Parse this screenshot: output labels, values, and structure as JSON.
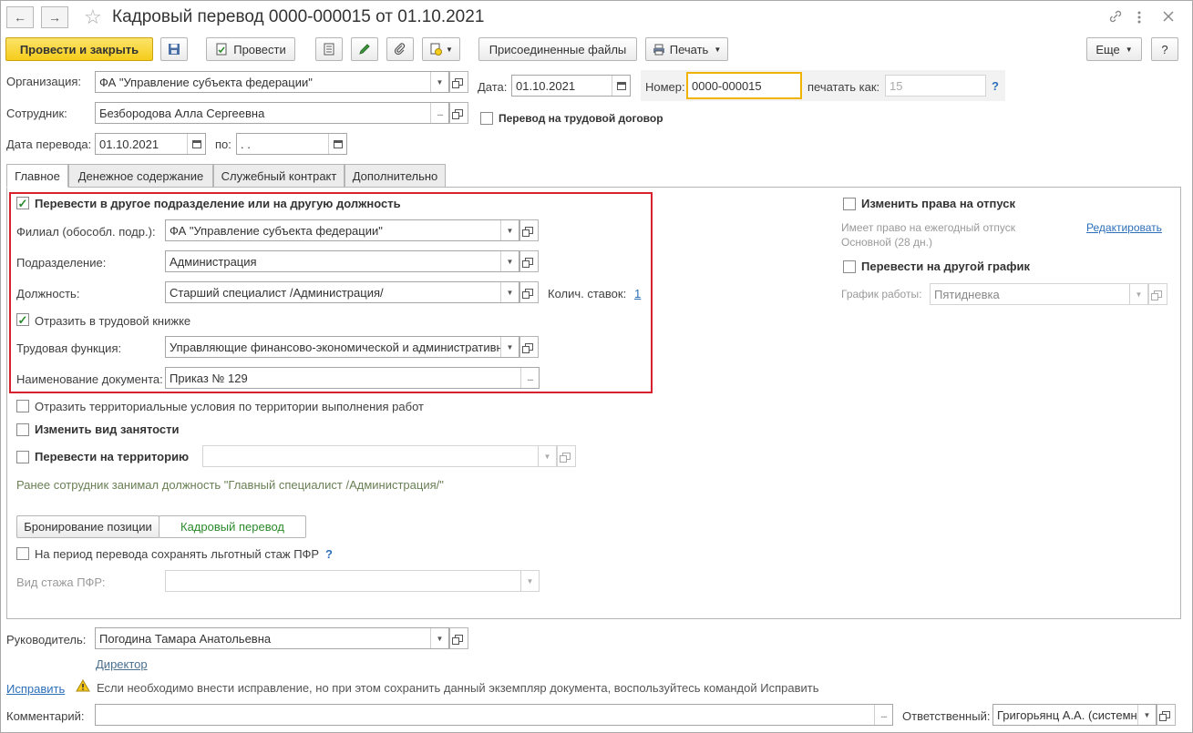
{
  "window": {
    "title": "Кадровый перевод 0000-000015 от 01.10.2021",
    "back_icon": "←",
    "forward_icon": "→",
    "star_icon": "☆"
  },
  "toolbar": {
    "post_close": "Провести и закрыть",
    "post": "Провести",
    "attached_files": "Присоединенные файлы",
    "print": "Печать",
    "more": "Еще",
    "help": "?"
  },
  "header": {
    "org_label": "Организация:",
    "org_value": "ФА \"Управление субъекта федерации\"",
    "date_label": "Дата:",
    "date_value": "01.10.2021",
    "number_label": "Номер:",
    "number_value": "0000-000015",
    "print_as_label": "печатать как:",
    "print_as_value": "15",
    "help_q": "?",
    "employee_label": "Сотрудник:",
    "employee_value": "Безбородова Алла Сергеевна",
    "labor_contract_label": "Перевод на трудовой договор",
    "transfer_date_label": "Дата перевода:",
    "transfer_date_value": "01.10.2021",
    "to_label": "по:",
    "to_value": " .  ."
  },
  "tabs": [
    "Главное",
    "Денежное содержание",
    "Служебный контракт",
    "Дополнительно"
  ],
  "main": {
    "transfer_checkbox": "Перевести в другое подразделение или на другую должность",
    "branch_label": "Филиал (обособл. подр.):",
    "branch_value": "ФА \"Управление субъекта федерации\"",
    "dept_label": "Подразделение:",
    "dept_value": "Администрация",
    "position_label": "Должность:",
    "position_value": "Старший специалист /Администрация/",
    "rates_label": "Колич. ставок:",
    "rates_value": "1",
    "workbook_checkbox": "Отразить в трудовой книжке",
    "labor_function_label": "Трудовая функция:",
    "labor_function_value": "Управляющие финансово-экономической и административн",
    "doc_name_label": "Наименование документа:",
    "doc_name_value": "Приказ № 129",
    "territorial_checkbox": "Отразить территориальные условия по территории выполнения работ",
    "employment_type_checkbox": "Изменить вид занятости",
    "territory_checkbox": "Перевести на территорию",
    "previous_note": "Ранее сотрудник занимал должность \"Главный специалист /Администрация/\"",
    "booking_button": "Бронирование позиции",
    "transfer_button": "Кадровый перевод",
    "pfr_checkbox": "На период перевода сохранять льготный стаж ПФР",
    "pfr_help": "?",
    "pfr_label": "Вид стажа ПФР:"
  },
  "right": {
    "vacation_checkbox": "Изменить права на отпуск",
    "vacation_note_1": "Имеет право на ежегодный отпуск",
    "vacation_note_2": "Основной (28 дн.)",
    "edit_link": "Редактировать",
    "schedule_checkbox": "Перевести на другой график",
    "schedule_label": "График работы:",
    "schedule_value": "Пятидневка"
  },
  "footer": {
    "manager_label": "Руководитель:",
    "manager_value": "Погодина Тамара Анатольевна",
    "manager_position": "Директор",
    "fix_link": "Исправить",
    "fix_note": "Если необходимо внести исправление, но при этом сохранить данный экземпляр документа, воспользуйтесь командой Исправить",
    "comment_label": "Комментарий:",
    "comment_value": "",
    "responsible_label": "Ответственный:",
    "responsible_value": "Григорьянц А.А. (системн"
  },
  "colors": {
    "primary_button": "#f5cd1a",
    "highlight_border": "#d8212f",
    "link": "#2d6fb8",
    "number_border": "#f0b400",
    "check": "#2c8b2c"
  }
}
